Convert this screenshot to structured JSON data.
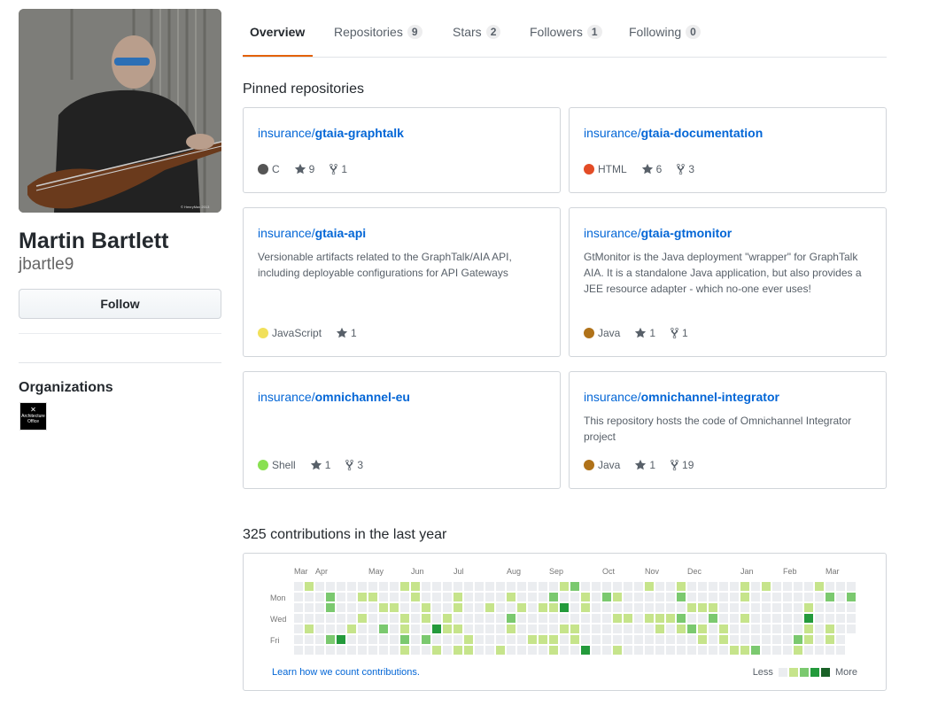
{
  "profile": {
    "full_name": "Martin Bartlett",
    "username": "jbartle9",
    "follow_label": "Follow",
    "organizations_title": "Organizations",
    "org_name": "Architecture Office",
    "photo_credit": "© HenryMax 2013"
  },
  "tabs": [
    {
      "label": "Overview",
      "count": null
    },
    {
      "label": "Repositories",
      "count": "9"
    },
    {
      "label": "Stars",
      "count": "2"
    },
    {
      "label": "Followers",
      "count": "1"
    },
    {
      "label": "Following",
      "count": "0"
    }
  ],
  "pinned_title": "Pinned repositories",
  "repos": [
    {
      "owner": "insurance/",
      "name": "gtaia-graphtalk",
      "description": "",
      "language": "C",
      "lang_color": "#555555",
      "stars": "9",
      "forks": "1"
    },
    {
      "owner": "insurance/",
      "name": "gtaia-documentation",
      "description": "",
      "language": "HTML",
      "lang_color": "#e34c26",
      "stars": "6",
      "forks": "3"
    },
    {
      "owner": "insurance/",
      "name": "gtaia-api",
      "description": "Versionable artifacts related to the GraphTalk/AIA API, including deployable configurations for API Gateways",
      "language": "JavaScript",
      "lang_color": "#f1e05a",
      "stars": "1",
      "forks": null
    },
    {
      "owner": "insurance/",
      "name": "gtaia-gtmonitor",
      "description": "GtMonitor is the Java deployment \"wrapper\" for GraphTalk AIA. It is a standalone Java application, but also provides a JEE resource adapter - which no-one ever uses!",
      "language": "Java",
      "lang_color": "#b07219",
      "stars": "1",
      "forks": "1"
    },
    {
      "owner": "insurance/",
      "name": "omnichannel-eu",
      "description": "",
      "language": "Shell",
      "lang_color": "#89e051",
      "stars": "1",
      "forks": "3"
    },
    {
      "owner": "insurance/",
      "name": "omnichannel-integrator",
      "description": "This repository hosts the code of Omnichannel Integrator project",
      "language": "Java",
      "lang_color": "#b07219",
      "stars": "1",
      "forks": "19"
    }
  ],
  "contributions": {
    "title": "325 contributions in the last year",
    "months": [
      "Mar",
      "Apr",
      "May",
      "Jun",
      "Jul",
      "Aug",
      "Sep",
      "Oct",
      "Nov",
      "Dec",
      "Jan",
      "Feb",
      "Mar"
    ],
    "weekdays": [
      "Mon",
      "Wed",
      "Fri"
    ],
    "learn_link": "Learn how we count contributions.",
    "legend_less": "Less",
    "legend_more": "More",
    "colors": [
      "#ebedf0",
      "#c6e48b",
      "#7bc96f",
      "#239a3b",
      "#196127"
    ]
  }
}
